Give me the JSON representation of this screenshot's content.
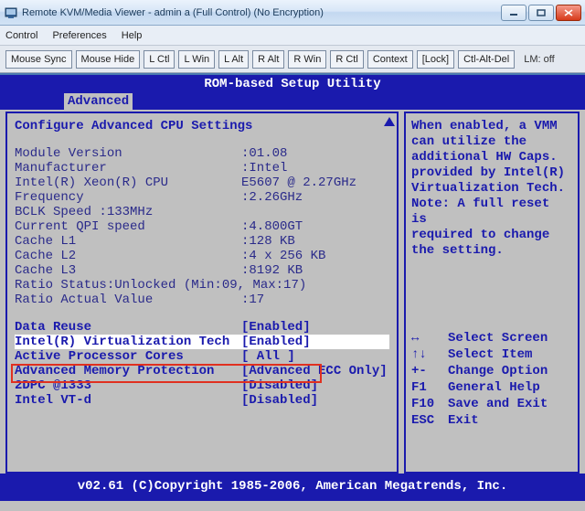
{
  "window": {
    "title": "Remote KVM/Media Viewer - admin a            (Full Control) (No Encryption)"
  },
  "menu": {
    "control": "Control",
    "preferences": "Preferences",
    "help": "Help"
  },
  "toolbar": {
    "mouse_sync": "Mouse Sync",
    "mouse_hide": "Mouse Hide",
    "lctl": "L Ctl",
    "lwin": "L Win",
    "lalt": "L Alt",
    "ralt": "R Alt",
    "rwin": "R Win",
    "rctl": "R Ctl",
    "context": "Context",
    "lock": "[Lock]",
    "cad": "Ctl-Alt-Del",
    "lm_off": "LM: off"
  },
  "bios": {
    "header": "ROM-based Setup Utility",
    "tab": "Advanced",
    "section_title": "Configure Advanced CPU Settings",
    "info": {
      "module_version_label": "Module Version",
      "module_version_value": ":01.08",
      "manufacturer_label": "Manufacturer",
      "manufacturer_value": ":Intel",
      "cpu_label": "Intel(R) Xeon(R) CPU",
      "cpu_value": "E5607  @ 2.27GHz",
      "frequency_label": "Frequency",
      "frequency_value": ":2.26GHz",
      "bclk_label": "BCLK Speed  :133MHz",
      "qpi_label": "Current QPI speed",
      "qpi_value": ":4.800GT",
      "cache_l1_label": "Cache L1",
      "cache_l1_value": ":128 KB",
      "cache_l2_label": "Cache L2",
      "cache_l2_value": ":4 x 256 KB",
      "cache_l3_label": "Cache L3",
      "cache_l3_value": ":8192 KB",
      "ratio_status_label": "Ratio Status:Unlocked (Min:09, Max:17)",
      "ratio_actual_label": "Ratio Actual Value",
      "ratio_actual_value": ":17"
    },
    "options": {
      "data_reuse_label": "Data Reuse",
      "data_reuse_value": "[Enabled]",
      "vt_label": "Intel(R) Virtualization Tech",
      "vt_value": "[Enabled]",
      "cores_label": "Active Processor Cores",
      "cores_value": "[ All ]",
      "amp_label": "Advanced Memory Protection",
      "amp_value": "[Advanced ECC Only]",
      "dpc_label": "2DPC @1333",
      "dpc_value": "[Disabled]",
      "vtd_label": "Intel VT-d",
      "vtd_value": "[Disabled]"
    },
    "help": {
      "line1": "When enabled, a VMM",
      "line2": "can utilize the",
      "line3": "additional HW Caps.",
      "line4": "provided by Intel(R)",
      "line5": "Virtualization Tech.",
      "line6": "Note: A full reset is",
      "line7": "required to change",
      "line8": "the setting."
    },
    "keys": {
      "k1": "↔",
      "d1": "Select Screen",
      "k2": "↑↓",
      "d2": "Select Item",
      "k3": "+-",
      "d3": "Change Option",
      "k4": "F1",
      "d4": "General Help",
      "k5": "F10",
      "d5": "Save and Exit",
      "k6": "ESC",
      "d6": "Exit"
    },
    "footer": "v02.61 (C)Copyright 1985-2006, American Megatrends, Inc."
  }
}
